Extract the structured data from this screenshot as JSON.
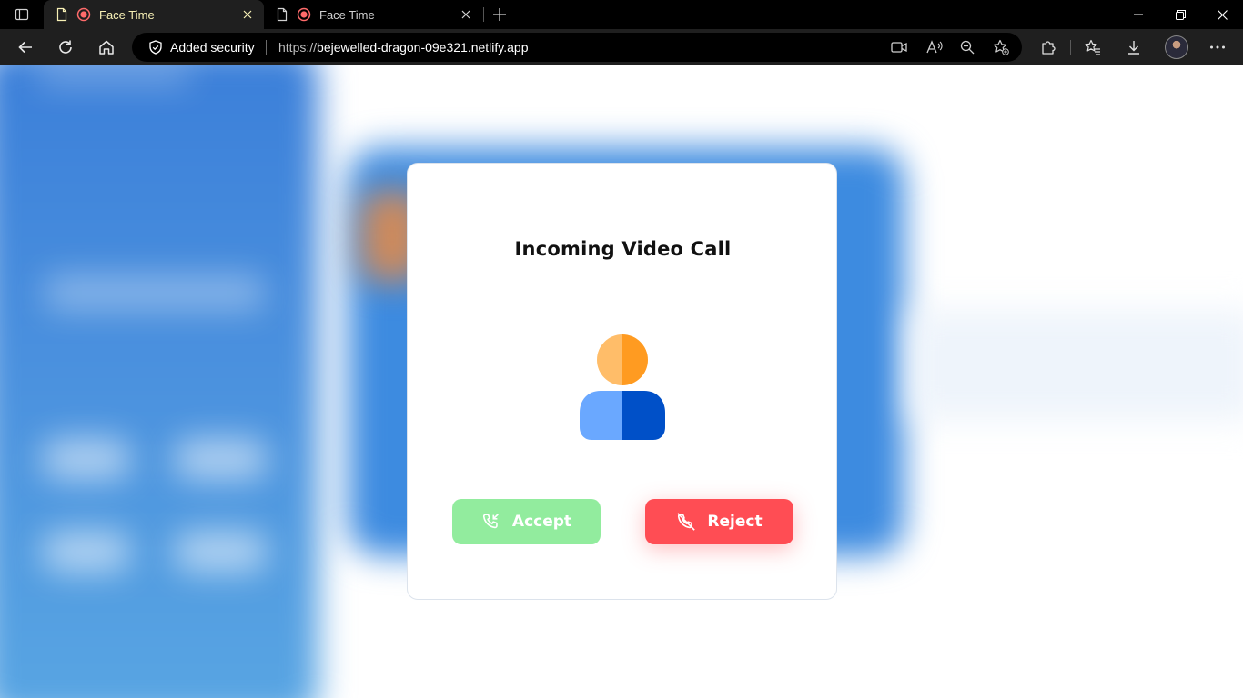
{
  "browser": {
    "tabs": [
      {
        "title": "Face Time",
        "active": true
      },
      {
        "title": "Face Time",
        "active": false
      }
    ],
    "security_label": "Added security",
    "url_scheme": "https://",
    "url_host": "bejewelled-dragon-09e321.netlify.app"
  },
  "dialog": {
    "title": "Incoming Video Call",
    "accept_label": "Accept",
    "reject_label": "Reject"
  },
  "colors": {
    "accept": "#92ec9e",
    "reject": "#ff4d54",
    "avatar_head_light": "#ffbd69",
    "avatar_head_dark": "#ff9b21",
    "avatar_body_light": "#6aa8ff",
    "avatar_body_dark": "#0050c8"
  },
  "icons": [
    "tab-actions-icon",
    "document-icon",
    "recording-icon",
    "close-icon",
    "new-tab-icon",
    "minimize-icon",
    "restore-icon",
    "window-close-icon",
    "back-icon",
    "refresh-icon",
    "home-icon",
    "shield-icon",
    "video-camera-icon",
    "read-aloud-icon",
    "zoom-out-icon",
    "favorite-add-icon",
    "extensions-icon",
    "favorites-icon",
    "downloads-icon",
    "more-icon",
    "incoming-call-icon",
    "call-end-icon",
    "user-icon"
  ]
}
